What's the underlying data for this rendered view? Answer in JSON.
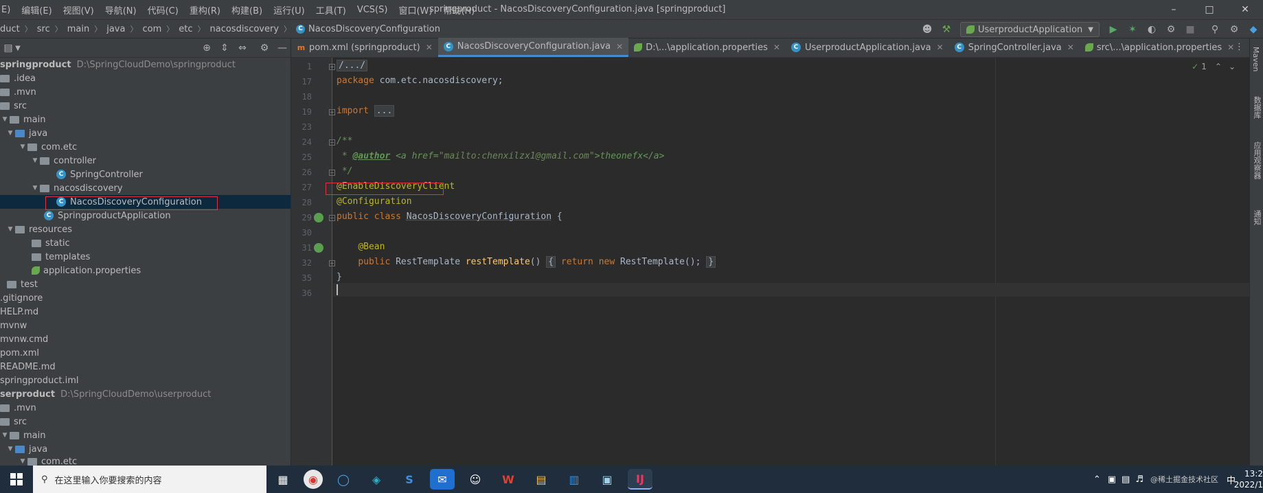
{
  "menu": {
    "items": [
      "E)",
      "编辑(E)",
      "视图(V)",
      "导航(N)",
      "代码(C)",
      "重构(R)",
      "构建(B)",
      "运行(U)",
      "工具(T)",
      "VCS(S)",
      "窗口(W)",
      "帮助(H)"
    ],
    "window_title": "springproduct - NacosDiscoveryConfiguration.java [springproduct]",
    "minimize": "–",
    "maximize": "□",
    "close": "✕"
  },
  "breadcrumb": [
    "duct",
    "src",
    "main",
    "java",
    "com",
    "etc",
    "nacosdiscovery",
    "NacosDiscoveryConfiguration"
  ],
  "toolbar": {
    "run_config": "UserproductApplication"
  },
  "project_tree": {
    "rows": [
      {
        "label": "springproduct",
        "path": "D:\\SpringCloudDemo\\springproduct",
        "bold": true
      },
      {
        "label": ".idea"
      },
      {
        "label": ".mvn"
      },
      {
        "label": "src"
      },
      {
        "label": "main"
      },
      {
        "label": "java"
      },
      {
        "label": "com.etc"
      },
      {
        "label": "controller"
      },
      {
        "label": "SpringController"
      },
      {
        "label": "nacosdiscovery"
      },
      {
        "label": "NacosDiscoveryConfiguration"
      },
      {
        "label": "SpringproductApplication"
      },
      {
        "label": "resources"
      },
      {
        "label": "static"
      },
      {
        "label": "templates"
      },
      {
        "label": "application.properties"
      },
      {
        "label": "test"
      },
      {
        "label": ".gitignore"
      },
      {
        "label": "HELP.md"
      },
      {
        "label": "mvnw"
      },
      {
        "label": "mvnw.cmd"
      },
      {
        "label": "pom.xml"
      },
      {
        "label": "README.md"
      },
      {
        "label": "springproduct.iml"
      },
      {
        "label": "serproduct",
        "path": "D:\\SpringCloudDemo\\userproduct",
        "bold": true
      },
      {
        "label": ".mvn"
      },
      {
        "label": "src"
      },
      {
        "label": "main"
      },
      {
        "label": "java"
      },
      {
        "label": "com.etc"
      }
    ]
  },
  "tabs": [
    {
      "label": "pom.xml (springproduct)"
    },
    {
      "label": "NacosDiscoveryConfiguration.java"
    },
    {
      "label": "D:\\...\\application.properties"
    },
    {
      "label": "UserproductApplication.java"
    },
    {
      "label": "SpringController.java"
    },
    {
      "label": "src\\...\\application.properties"
    }
  ],
  "editor": {
    "inspection_count": "1",
    "line_numbers": [
      "1",
      "17",
      "18",
      "19",
      "23",
      "24",
      "25",
      "26",
      "27",
      "28",
      "29",
      "30",
      "31",
      "32",
      "35",
      "36"
    ],
    "code": {
      "l1": "/.../",
      "l17_kw": "package",
      "l17_rest": " com.etc.nacosdiscovery;",
      "l19_kw": "import",
      "l19_fold": "...",
      "l24": "/**",
      "l25_star": " * ",
      "l25_tag": "@author",
      "l25_a1": " <a href=",
      "l25_str": "\"mailto:chenxilzx1@gmail.com\"",
      "l25_a2": ">theonefx</a>",
      "l26": " */",
      "l27": "@EnableDiscoveryClient",
      "l28": "@Configuration",
      "l29_kw": "public class",
      "l29_name": "NacosDiscoveryConfiguration",
      "l29_rest": " {",
      "l31": "@Bean",
      "l32_kw": "public",
      "l32_type": " RestTemplate ",
      "l32_fn": "restTemplate",
      "l32_paren": "() ",
      "l32_fold1": "{",
      "l32_kw2": " return new",
      "l32_rest": " RestTemplate();",
      "l32_fold2": "}",
      "l35": "}"
    }
  },
  "right_strip": {
    "maven": "Maven",
    "database": "数据库",
    "endpoints": "应用观察器",
    "notifications": "通知"
  },
  "taskbar": {
    "search_placeholder": "在这里输入你要搜索的内容",
    "time": "13:2",
    "date": "2022/1",
    "ime": "中",
    "watermark": "@稀土掘金技术社区"
  }
}
